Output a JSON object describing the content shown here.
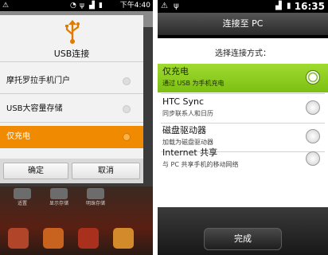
{
  "left": {
    "status": {
      "time": "下午4:40"
    },
    "dialog": {
      "title": "USB连接",
      "options": [
        {
          "label": "摩托罗拉手机门户",
          "selected": false
        },
        {
          "label": "USB大容量存储",
          "selected": false
        },
        {
          "label": "仅充电",
          "selected": true
        }
      ],
      "ok_label": "确定",
      "cancel_label": "取消"
    },
    "home_shortcuts": [
      "适置",
      "显示存储",
      "明珠存储"
    ],
    "colors": {
      "accent": "#f08a00"
    }
  },
  "right": {
    "status": {
      "time": "16:35"
    },
    "title": "连接至 PC",
    "prompt": "选择连接方式：",
    "options": [
      {
        "label": "仅充电",
        "description": "通过 USB 为手机充电",
        "selected": true
      },
      {
        "label": "HTC Sync",
        "description": "同步联系人和日历",
        "selected": false
      },
      {
        "label": "磁盘驱动器",
        "description": "加载为磁盘驱动器",
        "selected": false
      },
      {
        "label": "Internet 共享",
        "description": "与 PC 共享手机的移动网络",
        "selected": false
      }
    ],
    "done_label": "完成",
    "colors": {
      "accent": "#8fd020"
    }
  }
}
